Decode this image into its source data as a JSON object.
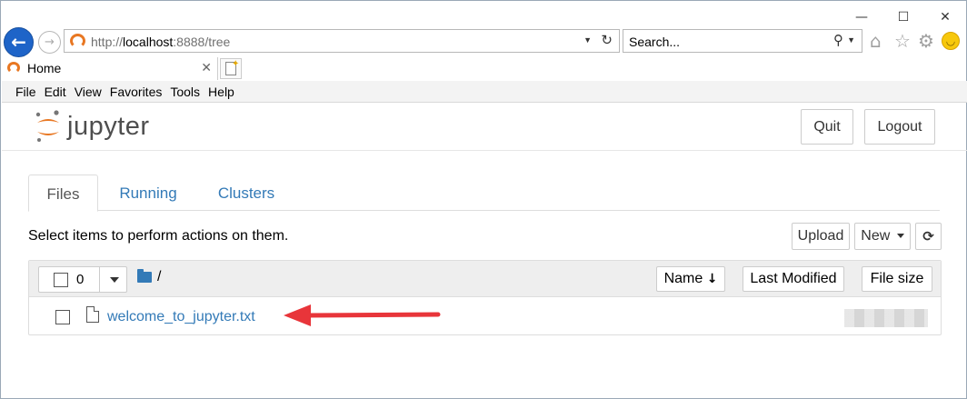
{
  "browser": {
    "window_controls": {
      "minimize": "—",
      "maximize": "☐",
      "close": "✕"
    },
    "url_scheme": "http://",
    "url_host": "localhost",
    "url_rest": ":8888/tree",
    "search_placeholder": "Search...",
    "tab_title": "Home",
    "tab_close": "✕",
    "menu": [
      "File",
      "Edit",
      "View",
      "Favorites",
      "Tools",
      "Help"
    ],
    "icons": {
      "back": "back-arrow-icon",
      "forward": "forward-arrow-icon",
      "home": "home-icon",
      "favorites": "star-icon",
      "settings": "gear-icon",
      "feedback": "smiley-icon"
    }
  },
  "jupyter": {
    "logo_text": "jupyter",
    "quit_label": "Quit",
    "logout_label": "Logout",
    "tabs": [
      {
        "label": "Files",
        "active": true
      },
      {
        "label": "Running",
        "active": false
      },
      {
        "label": "Clusters",
        "active": false
      }
    ],
    "instructions": "Select items to perform actions on them.",
    "upload_label": "Upload",
    "new_label": "New",
    "selected_count": "0",
    "breadcrumb": "/",
    "col_name": "Name",
    "col_modified": "Last Modified",
    "col_size": "File size",
    "files": [
      {
        "name": "welcome_to_jupyter.txt"
      }
    ],
    "colors": {
      "link": "#337ab7",
      "annotation_arrow": "#e8353a",
      "logo_orange": "#e87722"
    }
  }
}
